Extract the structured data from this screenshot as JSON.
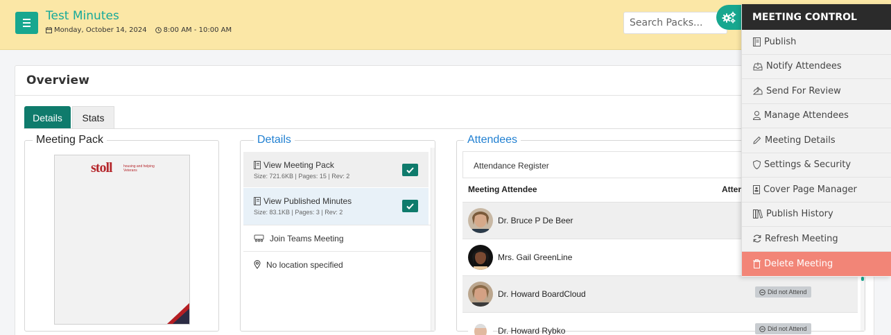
{
  "header": {
    "title": "Test Minutes",
    "date": "Monday, October 14, 2024",
    "time": "8:00 AM - 10:00 AM",
    "search_placeholder": "Search Packs...",
    "accent_color": "#17a78f",
    "background_color": "#fbe7a6"
  },
  "overview": {
    "title": "Overview",
    "tabs": [
      {
        "label": "Details",
        "active": true
      },
      {
        "label": "Stats",
        "active": false
      }
    ]
  },
  "meeting_pack": {
    "legend": "Meeting Pack",
    "logo_text": "stoll",
    "logo_tagline": "housing and helping Veterans"
  },
  "details": {
    "legend": "Details",
    "items": [
      {
        "label": "View Meeting Pack",
        "meta": "Size: 721.6KB | Pages: 15 | Rev: 2",
        "checked": true,
        "icon": "document-icon"
      },
      {
        "label": "View Published Minutes",
        "meta": "Size: 83.1KB | Pages: 3 | Rev: 2",
        "checked": true,
        "icon": "document-icon"
      }
    ],
    "teams_label": "Join Teams Meeting",
    "location_label": "No location specified"
  },
  "attendees": {
    "legend": "Attendees",
    "register_label": "Attendance Register",
    "col_attendee": "Meeting Attendee",
    "col_attendance": "Atten",
    "rows": [
      {
        "name": "Dr. Bruce P De Beer",
        "status": ""
      },
      {
        "name": "Mrs. Gail GreenLine",
        "status": ""
      },
      {
        "name": "Dr. Howard BoardCloud",
        "status": "Did not Attend"
      },
      {
        "name": "Dr. Howard Rybko",
        "status": "Did not Attend"
      }
    ]
  },
  "meeting_control": {
    "title": "MEETING CONTROL",
    "items": [
      {
        "label": "Publish",
        "icon": "document-icon"
      },
      {
        "label": "Notify Attendees",
        "icon": "inbox-icon"
      },
      {
        "label": "Send For Review",
        "icon": "upload-tray-icon"
      },
      {
        "label": "Manage Attendees",
        "icon": "user-icon"
      },
      {
        "label": "Meeting Details",
        "icon": "pencil-icon"
      },
      {
        "label": "Settings & Security",
        "icon": "shield-icon"
      },
      {
        "label": "Cover Page Manager",
        "icon": "id-card-icon"
      },
      {
        "label": "Publish History",
        "icon": "books-icon"
      },
      {
        "label": "Refresh Meeting",
        "icon": "refresh-icon"
      },
      {
        "label": "Delete Meeting",
        "icon": "trash-icon",
        "danger": true
      }
    ],
    "danger_color": "#f28577"
  }
}
